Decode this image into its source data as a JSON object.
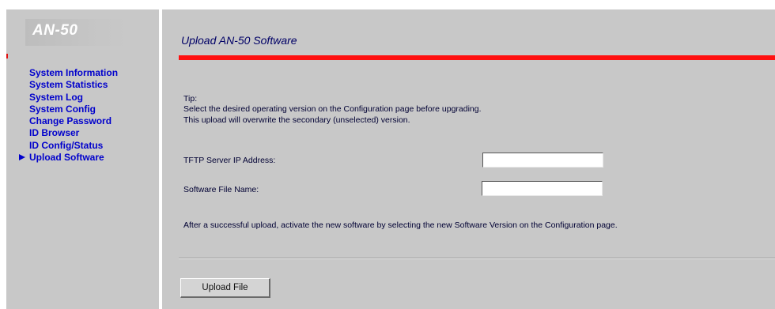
{
  "logo": "AN-50",
  "nav": {
    "items": [
      {
        "label": "System Information"
      },
      {
        "label": "System Statistics"
      },
      {
        "label": "System Log"
      },
      {
        "label": "System Config"
      },
      {
        "label": "Change Password"
      },
      {
        "label": "ID Browser"
      },
      {
        "label": "ID Config/Status"
      },
      {
        "label": "Upload Software",
        "active": true
      }
    ]
  },
  "main": {
    "title": "Upload AN-50 Software",
    "tip": {
      "label": "Tip:",
      "line1": "Select the desired operating version on the Configuration page before upgrading.",
      "line2": "This upload will overwrite the secondary (unselected) version."
    },
    "form": {
      "tftp_label": "TFTP Server IP Address:",
      "tftp_value": "",
      "file_label": "Software File Name:",
      "file_value": ""
    },
    "after_note": "After a successful upload, activate the new software by selecting the new Software Version on the Configuration page.",
    "upload_button": "Upload File"
  },
  "colors": {
    "panel_bg": "#c8c8c8",
    "nav_link": "#0000cc",
    "accent_bar": "#ff1010",
    "title": "#000066"
  },
  "icons": {
    "active_nav_marker": "triangle-right-icon"
  }
}
